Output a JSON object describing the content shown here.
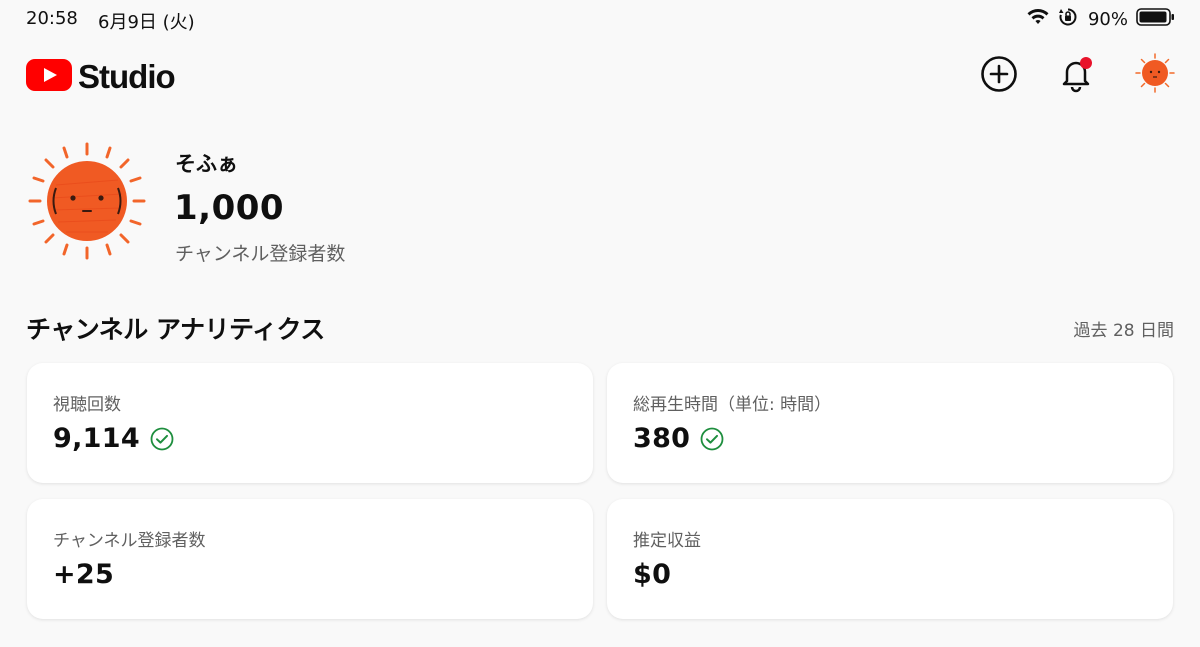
{
  "status_bar": {
    "time": "20:58",
    "date": "6月9日 (火)",
    "battery": "90%",
    "icons": [
      "wifi-icon",
      "orientation-lock-icon",
      "battery-icon"
    ]
  },
  "header": {
    "logo_text": "Studio",
    "brand_color": "#ff0000",
    "actions": [
      "create-icon",
      "bell-icon",
      "avatar"
    ],
    "notification_dot_color": "#e8132b"
  },
  "channel": {
    "name": "そふぁ",
    "subscriber_count": "1,000",
    "subscriber_label": "チャンネル登録者数"
  },
  "analytics": {
    "title": "チャンネル アナリティクス",
    "period": "過去 28 日間",
    "cards": [
      {
        "label": "視聴回数",
        "value": "9,114",
        "verified": true
      },
      {
        "label": "総再生時間（単位: 時間）",
        "value": "380",
        "verified": true
      },
      {
        "label": "チャンネル登録者数",
        "value": "+25",
        "verified": false
      },
      {
        "label": "推定収益",
        "value": "$0",
        "verified": false
      }
    ],
    "check_color": "#1e8e3e"
  }
}
